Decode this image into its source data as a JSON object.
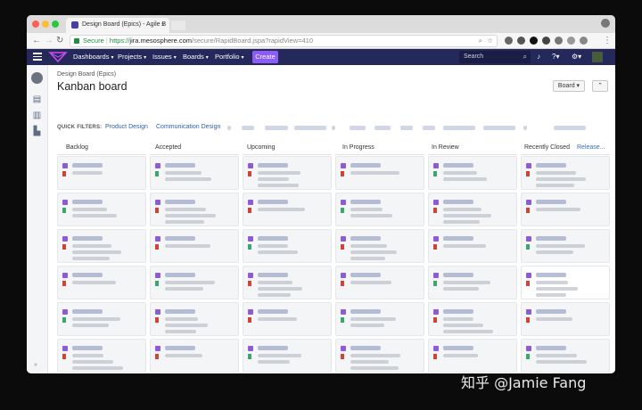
{
  "browser": {
    "tab_title": "Design Board (Epics) - Agile B",
    "secure_label": "Secure",
    "url_proto": "https://",
    "url_host": "jira.mesosphere.com",
    "url_path": "/secure/RapidBoard.jspa?rapidView=410"
  },
  "nav": {
    "items": [
      {
        "label": "Dashboards"
      },
      {
        "label": "Projects"
      },
      {
        "label": "Issues"
      },
      {
        "label": "Boards"
      },
      {
        "label": "Portfolio"
      }
    ],
    "create_label": "Create",
    "search_placeholder": "Search"
  },
  "board": {
    "breadcrumb": "Design Board (Epics)",
    "title": "Kanban board",
    "board_button": "Board",
    "expand_button": "⌃",
    "quick_filters_label": "QUICK FILTERS:",
    "quick_filters": [
      "Product Design",
      "Communication Design"
    ],
    "columns": [
      {
        "name": "Backlog"
      },
      {
        "name": "Accepted"
      },
      {
        "name": "Upcoming"
      },
      {
        "name": "In Progress"
      },
      {
        "name": "In Review"
      },
      {
        "name": "Recently Closed"
      }
    ],
    "release_link": "Release..."
  },
  "watermark": "知乎 @Jamie Fang",
  "colors": {
    "nav_bg": "#24285b",
    "create_button": "#8b5cf6",
    "epic_icon": "#8e5bd6",
    "link": "#2f5fa8"
  }
}
